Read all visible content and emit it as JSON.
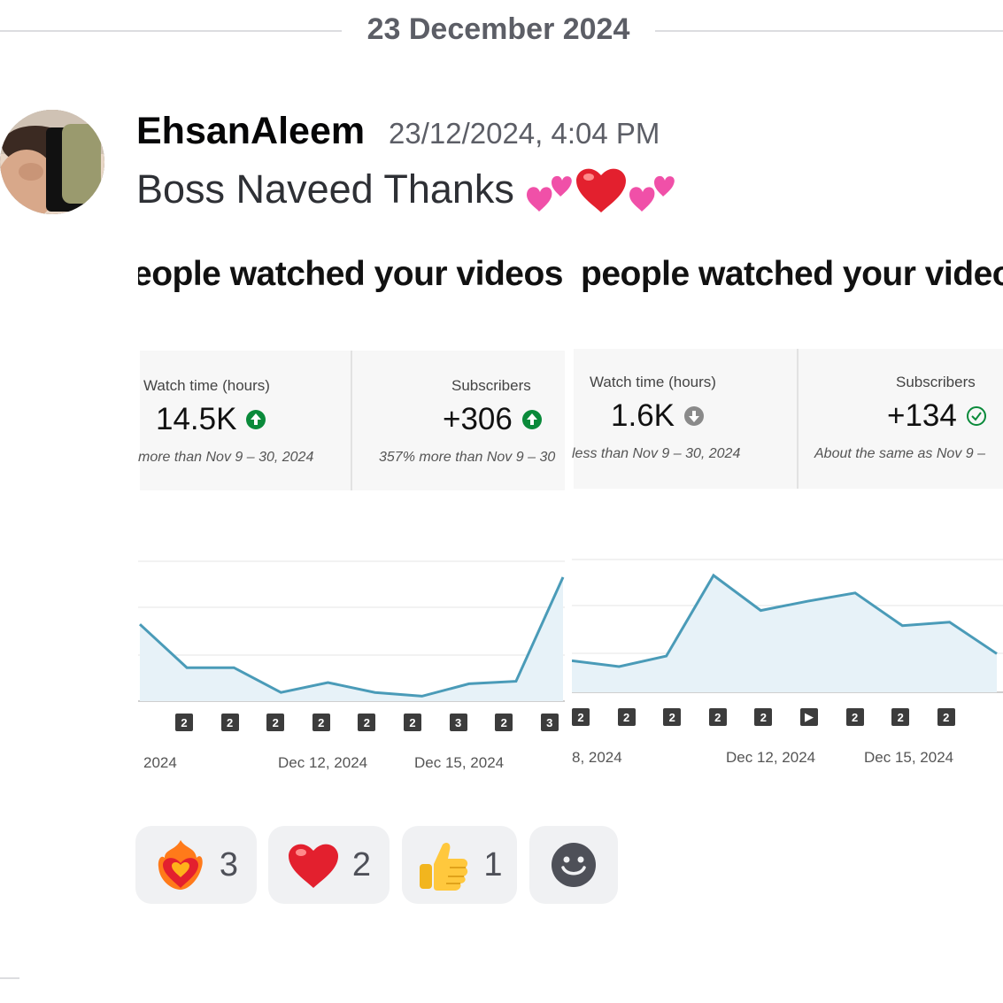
{
  "date_divider": "23 December 2024",
  "message": {
    "username": "EhsanAleem",
    "timestamp": "23/12/2024, 4:04 PM",
    "text": "Boss Naveed Thanks"
  },
  "attachment": {
    "panel1": {
      "headline": "eople watched your videos",
      "watch_label": "Watch time (hours)",
      "watch_value": "14.5K",
      "watch_note": "more than Nov 9 – 30, 2024",
      "subs_label": "Subscribers",
      "subs_value": "+306",
      "subs_note": "357% more than Nov 9 – 30",
      "x_labels": [
        "2024",
        "Dec 12, 2024",
        "Dec 15, 2024"
      ],
      "badges": [
        "2",
        "2",
        "2",
        "2",
        "2",
        "2",
        "3",
        "2",
        "3"
      ]
    },
    "panel2": {
      "headline": "people watched your video",
      "watch_label": "Watch time (hours)",
      "watch_value": "1.6K",
      "watch_note": "less than Nov 9 – 30, 2024",
      "subs_label": "Subscribers",
      "subs_value": "+134",
      "subs_note": "About the same as Nov 9 –",
      "x_labels": [
        "8, 2024",
        "Dec 12, 2024",
        "Dec 15, 2024"
      ],
      "badges": [
        "2",
        "2",
        "2",
        "2",
        "2",
        "▶",
        "2",
        "2",
        "2"
      ]
    }
  },
  "chart_data": [
    {
      "type": "area",
      "x": [
        1,
        2,
        3,
        4,
        5,
        6,
        7,
        8,
        9,
        10
      ],
      "y": [
        0.62,
        0.27,
        0.27,
        0.07,
        0.15,
        0.07,
        0.04,
        0.14,
        0.16,
        1.0
      ]
    },
    {
      "type": "area",
      "x": [
        1,
        2,
        3,
        4,
        5,
        6,
        7,
        8,
        9,
        10
      ],
      "y": [
        0.27,
        0.22,
        0.31,
        1.0,
        0.7,
        0.78,
        0.85,
        0.57,
        0.6,
        0.33
      ]
    }
  ],
  "reactions": [
    {
      "emoji": "heart-on-fire",
      "count": "3"
    },
    {
      "emoji": "red-heart",
      "count": "2"
    },
    {
      "emoji": "thumbs-up",
      "count": "1"
    },
    {
      "emoji": "add-reaction",
      "count": ""
    }
  ],
  "colors": {
    "accent_line": "#4a9bb8",
    "area_fill": "#e7f2f8",
    "up_badge": "#0a8a3a",
    "neutral_badge": "#8a8a8a"
  }
}
